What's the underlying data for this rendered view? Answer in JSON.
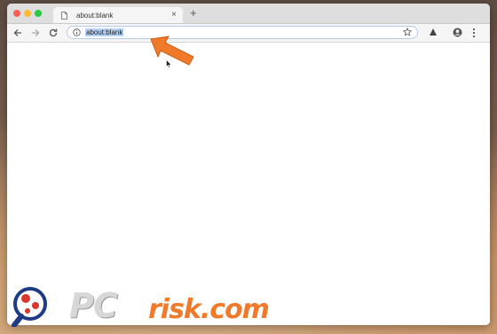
{
  "tab": {
    "title": "about:blank",
    "close_symbol": "×",
    "icon": "document-icon"
  },
  "new_tab_symbol": "+",
  "toolbar": {
    "back_icon": "arrow-left-icon",
    "forward_icon": "arrow-right-icon",
    "reload_icon": "reload-icon",
    "omnibox": {
      "url": "about:blank",
      "info_icon": "info-icon",
      "bookmark_icon": "star-icon"
    },
    "extension_icon": "extension-triangle-icon",
    "account_icon": "account-icon",
    "menu_icon": "three-dot-menu-icon"
  },
  "overlay": {
    "arrow_color": "#f07a2a",
    "arrow_icon": "pointer-arrow-icon"
  },
  "watermark": {
    "brand_pc": "PC",
    "brand_rest": "risk.com",
    "accent": "#f07a2a"
  }
}
